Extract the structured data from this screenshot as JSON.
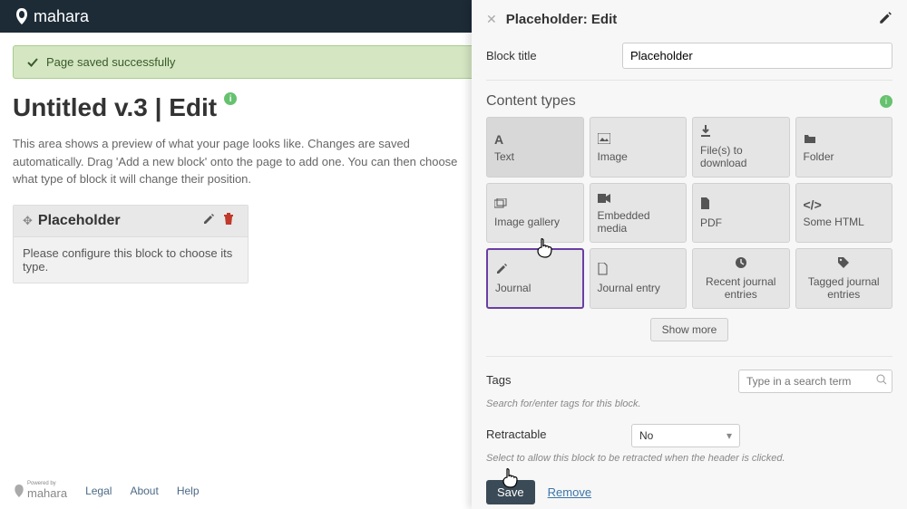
{
  "topbar": {
    "brand": "mahara"
  },
  "alert": {
    "text": "Page saved successfully"
  },
  "page": {
    "title": "Untitled v.3 | Edit",
    "description": "This area shows a preview of what your page looks like. Changes are saved automatically. Drag 'Add a new block' onto the page to add one. You can then choose what type of block it will change their position."
  },
  "block": {
    "title": "Placeholder",
    "body": "Please configure this block to choose its type."
  },
  "footer": {
    "poweredby": "mahara",
    "poweredby_prefix": "Powered by",
    "links": {
      "legal": "Legal",
      "about": "About",
      "help": "Help"
    }
  },
  "panel": {
    "title": "Placeholder: Edit",
    "block_title_label": "Block title",
    "block_title_value": "Placeholder",
    "content_types_label": "Content types",
    "tiles": [
      {
        "label": "Text"
      },
      {
        "label": "Image"
      },
      {
        "label": "File(s) to download"
      },
      {
        "label": "Folder"
      },
      {
        "label": "Image gallery"
      },
      {
        "label": "Embedded media"
      },
      {
        "label": "PDF"
      },
      {
        "label": "Some HTML"
      },
      {
        "label": "Journal"
      },
      {
        "label": "Journal entry"
      },
      {
        "label": "Recent journal entries"
      },
      {
        "label": "Tagged journal entries"
      }
    ],
    "show_more": "Show more",
    "tags_label": "Tags",
    "tags_placeholder": "Type in a search term",
    "tags_hint": "Search for/enter tags for this block.",
    "retractable_label": "Retractable",
    "retractable_value": "No",
    "retractable_hint": "Select to allow this block to be retracted when the header is clicked.",
    "save": "Save",
    "remove": "Remove"
  }
}
